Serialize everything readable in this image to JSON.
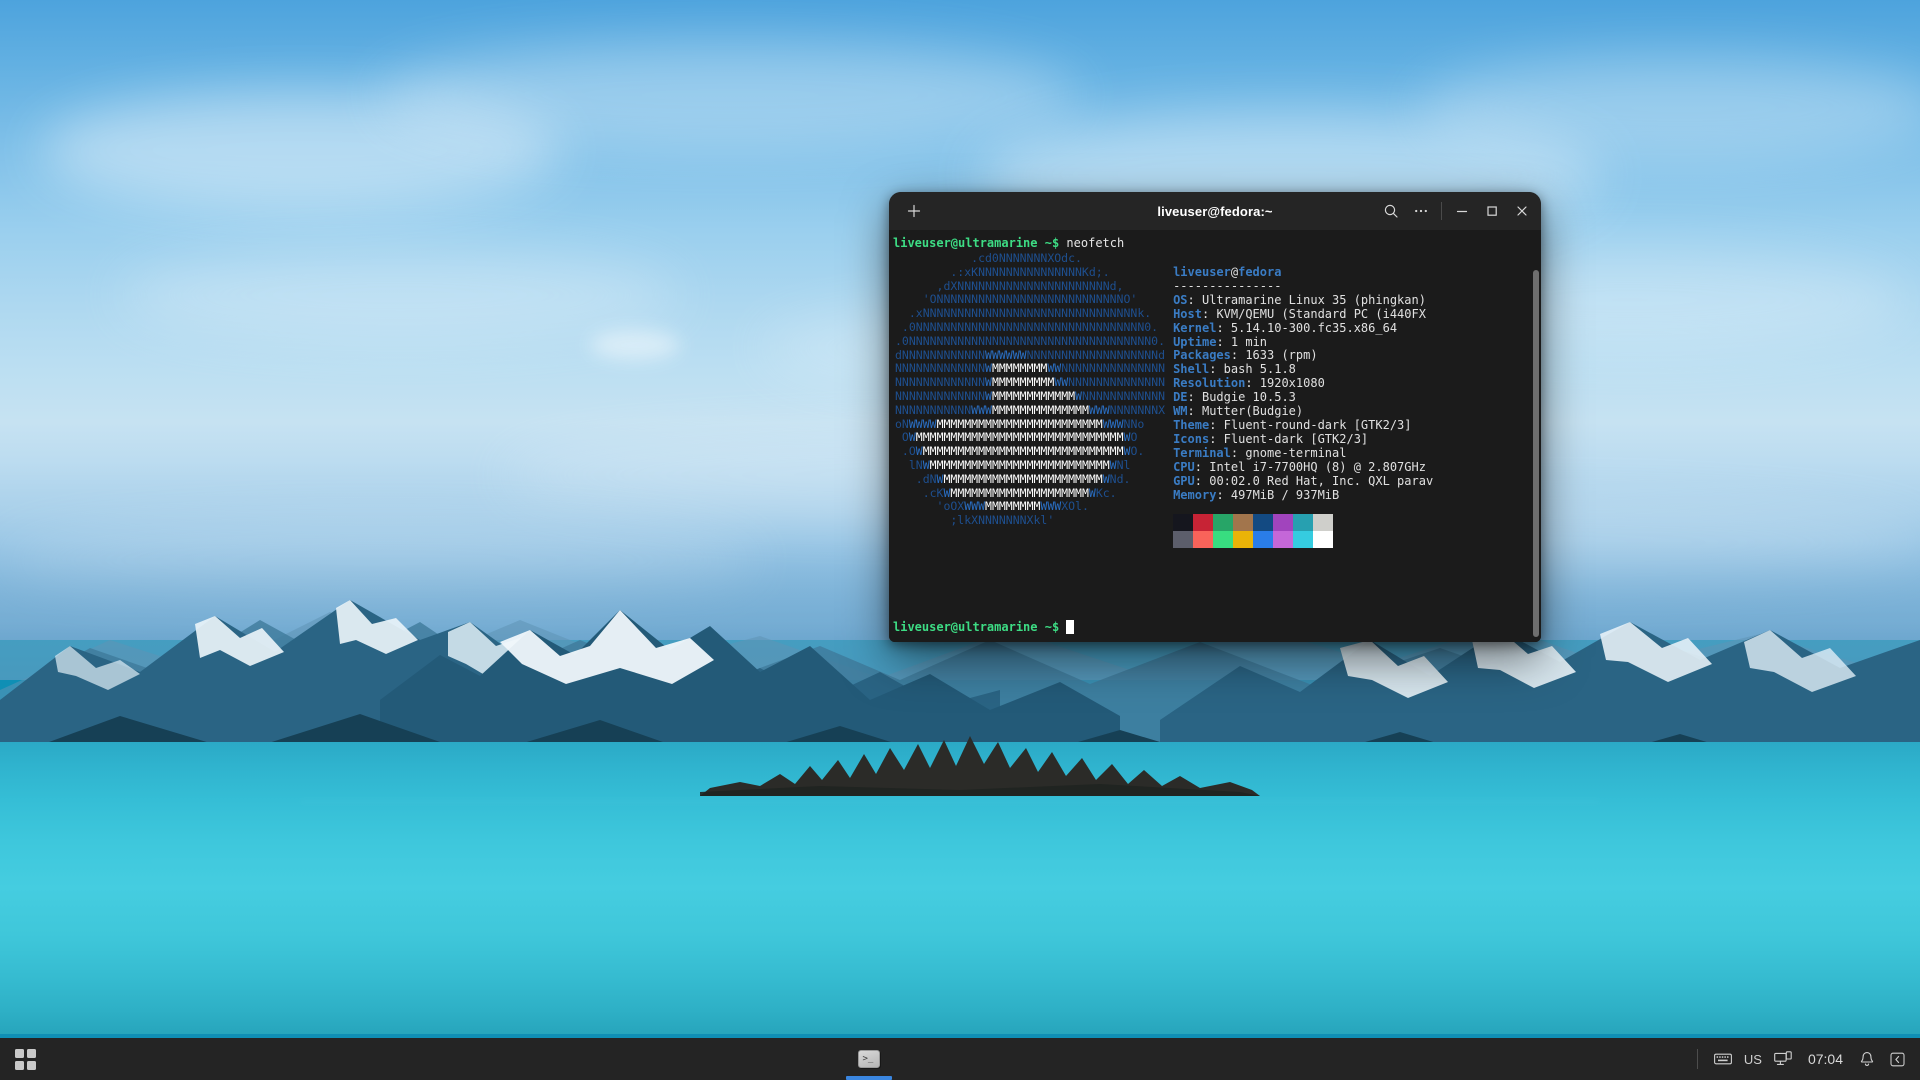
{
  "desktop": {
    "wallpaper_name": "garibaldi-lake-mountains",
    "wallpaper_colors": {
      "sky_top": "#4da3dd",
      "sky_bottom": "#5fa2d0",
      "lake": "#3ec7dc",
      "mountain_dark": "#123a4f",
      "mountain_mid": "#1d5570",
      "snow": "#e8f2f7"
    }
  },
  "window": {
    "title": "liveuser@fedora:~",
    "new_tab_label": "+",
    "buttons": {
      "new_tab": "new-tab",
      "search": "search",
      "menu": "menu",
      "minimize": "minimize",
      "maximize": "maximize",
      "close": "close"
    },
    "bg_color": "#1b1b1b",
    "header_color": "#252525"
  },
  "terminal": {
    "command_line": {
      "user_host": "liveuser@ultramarine",
      "path_symbol": "~$",
      "command": "neofetch"
    },
    "bottom_prompt": {
      "user_host": "liveuser@ultramarine",
      "path_symbol": "~$",
      "command": ""
    },
    "ascii_art": {
      "color_primary": "#1e4f8f",
      "color_mid": "#2a6fc4",
      "color_highlight": "#ffffff",
      "lines": [
        "           .cd0NNNNNNNXOdc.",
        "        .:xKNNNNNNNNNNNNNNNKd;.",
        "      ,dXNNNNNNNNNNNNNNNNNNNNNNd,",
        "    'ONNNNNNNNNNNNNNNNNNNNNNNNNNNO'",
        "  .xNNNNNNNNNNNNNNNNNNNNNNNNNNNNNNNk.",
        " .0NNNNNNNNNNNNNNNNNNNNNNNNNNNNNNNNN0.",
        ".0NNNNNNNNNNNNNNNNNNNNNNNNNNNNNNNNNNN0.",
        "dNNNNNNNNNNNNWWWWWWNNNNNNNNNNNNNNNNNNNd",
        "NNNNNNNNNNNNNWMMMMMMMMWWNNNNNNNNNNNNNNN",
        "NNNNNNNNNNNNNWMMMMMMMMMWWNNNNNNNNNNNNNN",
        "NNNNNNNNNNNNNWMMMMMMMMMMMMWNNNNNNNNNNNN",
        "NNNNNNNNNNNWWWMMMMMMMMMMMMMMWWWNNNNNNNX",
        "oNWWWWMMMMMMMMMMMMMMMMMMMMMMMMWWWNNo",
        " OWMMMMMMMMMMMMMMMMMMMMMMMMMMMMMMWO",
        " .OWMMMMMMMMMMMMMMMMMMMMMMMMMMMMMWO.",
        "  lNWMMMMMMMMMMMMMMMMMMMMMMMMMMWNl",
        "   .dNWMMMMMMMMMMMMMMMMMMMMMMMWNd.",
        "    .cKWMMMMMMMMMMMMMMMMMMMMWKc.",
        "      'oOXWWWMMMMMMMMWWWXOl.",
        "        ;lkXNNNNNNNXkl'"
      ]
    },
    "info": {
      "title_user": "liveuser",
      "title_at": "@",
      "title_host": "fedora",
      "rule": "---------------",
      "key_color": "#3a7cc4",
      "value_color": "#e0e0e0",
      "entries": [
        {
          "key": "OS",
          "value": "Ultramarine Linux 35 (phingkan)"
        },
        {
          "key": "Host",
          "value": "KVM/QEMU (Standard PC (i440FX"
        },
        {
          "key": "Kernel",
          "value": "5.14.10-300.fc35.x86_64"
        },
        {
          "key": "Uptime",
          "value": "1 min"
        },
        {
          "key": "Packages",
          "value": "1633 (rpm)"
        },
        {
          "key": "Shell",
          "value": "bash 5.1.8"
        },
        {
          "key": "Resolution",
          "value": "1920x1080"
        },
        {
          "key": "DE",
          "value": "Budgie 10.5.3"
        },
        {
          "key": "WM",
          "value": "Mutter(Budgie)"
        },
        {
          "key": "Theme",
          "value": "Fluent-round-dark [GTK2/3]"
        },
        {
          "key": "Icons",
          "value": "Fluent-dark [GTK2/3]"
        },
        {
          "key": "Terminal",
          "value": "gnome-terminal"
        },
        {
          "key": "CPU",
          "value": "Intel i7-7700HQ (8) @ 2.807GHz"
        },
        {
          "key": "GPU",
          "value": "00:02.0 Red Hat, Inc. QXL parav"
        },
        {
          "key": "Memory",
          "value": "497MiB / 937MiB"
        }
      ]
    },
    "palette": {
      "row_normal": [
        "#15161e",
        "#c72335",
        "#27a567",
        "#a2754c",
        "#134a82",
        "#a144bd",
        "#27a0b0",
        "#cfcfcb"
      ],
      "row_bright": [
        "#5c5e6b",
        "#f9635a",
        "#38dd80",
        "#eab308",
        "#2a7de8",
        "#c467d8",
        "#35cce0",
        "#ffffff"
      ]
    }
  },
  "taskbar": {
    "menu_button_label": "Menu",
    "tasks": [
      {
        "label": "Terminal",
        "icon": "terminal-icon",
        "active": true
      }
    ],
    "tray": {
      "keyboard_icon": "keyboard-icon",
      "keyboard_layout": "US",
      "network_icon": "network-display-icon",
      "clock": "07:04",
      "notification_icon": "bell-icon",
      "expand_icon": "chevron-left-icon"
    },
    "bg_color": "#242424",
    "active_indicator_color": "#3a86e0"
  }
}
